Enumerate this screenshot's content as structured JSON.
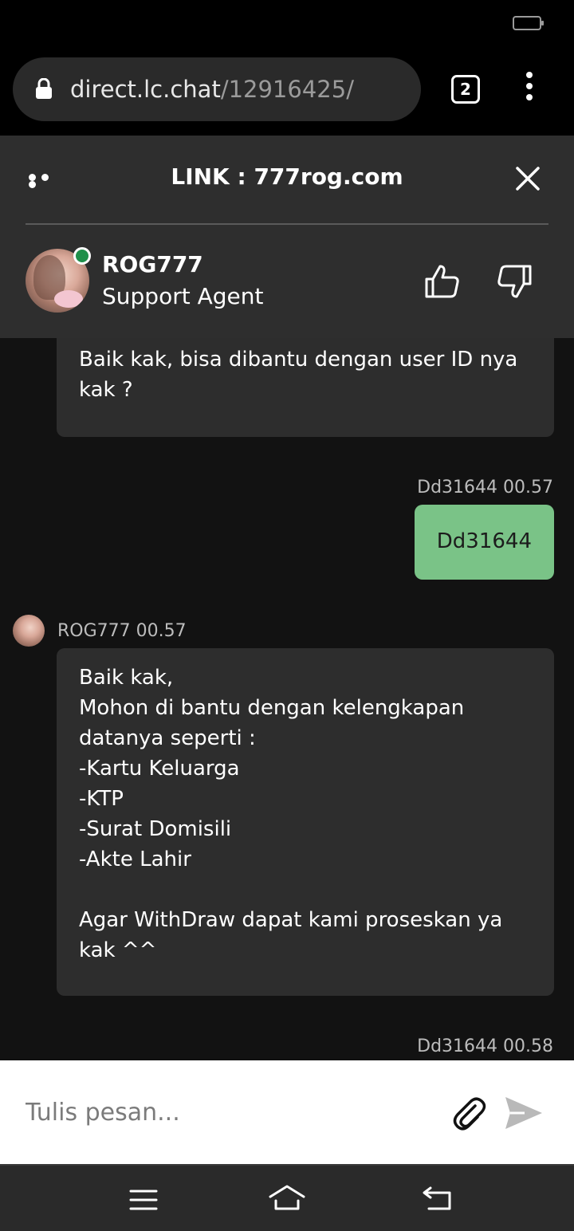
{
  "browser": {
    "url_host": "direct.lc.chat",
    "url_path": "/12916425/",
    "tab_count": "2"
  },
  "header": {
    "title": "LINK : 777rog.com",
    "agent_name": "ROG777",
    "agent_role": "Support Agent"
  },
  "messages": {
    "m1_text": "Baik kak, bisa dibantu dengan user ID nya\nkak ?",
    "m2_meta": "Dd31644 00.57",
    "m2_text": "Dd31644",
    "m3_meta": "ROG777 00.57",
    "m3_text": "Baik kak,\nMohon di bantu dengan kelengkapan\ndatanya seperti :\n-Kartu Keluarga\n-KTP\n-Surat Domisili\n-Akte Lahir\n\nAgar WithDraw dapat kami proseskan ya\nkak ^^",
    "m4_meta": "Dd31644 00.58"
  },
  "composer": {
    "placeholder": "Tulis pesan..."
  },
  "colors": {
    "user_bubble": "#7ac387",
    "agent_bubble": "#2d2d2d",
    "online": "#1f8f4a"
  }
}
